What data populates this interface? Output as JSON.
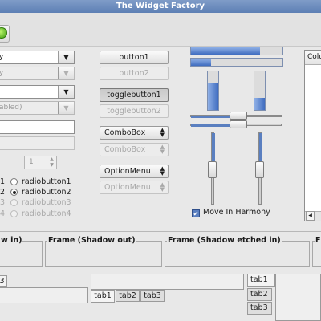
{
  "window": {
    "title": "The Widget Factory"
  },
  "combos": {
    "c1": "y",
    "c2": "y",
    "c3": "",
    "c4": "abled)"
  },
  "spin": {
    "value": "1"
  },
  "radios": [
    {
      "num": "1",
      "label": "radiobutton1",
      "checked": false,
      "disabled": false
    },
    {
      "num": "2",
      "label": "radiobutton2",
      "checked": true,
      "disabled": false
    },
    {
      "num": "3",
      "label": "radiobutton3",
      "checked": false,
      "disabled": true
    },
    {
      "num": "4",
      "label": "radiobutton4",
      "checked": false,
      "disabled": true
    }
  ],
  "buttons": {
    "button1": "button1",
    "button2": "button2",
    "toggle1": "togglebutton1",
    "toggle2": "togglebutton2",
    "combo1": "ComboBox",
    "combo2": "ComboBox",
    "option1": "OptionMenu",
    "option2": "OptionMenu"
  },
  "progress": {
    "h1": 0.75,
    "h2": 0.22,
    "v1": 0.68,
    "v2": 0.32
  },
  "scales": {
    "h1": 0.5,
    "h2": 0.5,
    "v1": 0.5,
    "v2": 0.5
  },
  "checkbox": {
    "label": "Move In Harmony",
    "checked": true
  },
  "tree": {
    "column": "Colu"
  },
  "frames": {
    "in": "w in)",
    "out": "Frame (Shadow out)",
    "etched_in": "Frame (Shadow etched in)",
    "f4": "F"
  },
  "notebooks": {
    "nb1_tab": "3",
    "nb2_tabs": [
      "tab1",
      "tab2",
      "tab3"
    ],
    "nb3_tabs": [
      "tab1",
      "tab2",
      "tab3"
    ]
  },
  "icons": {
    "toolbar": "green-circle-icon"
  }
}
